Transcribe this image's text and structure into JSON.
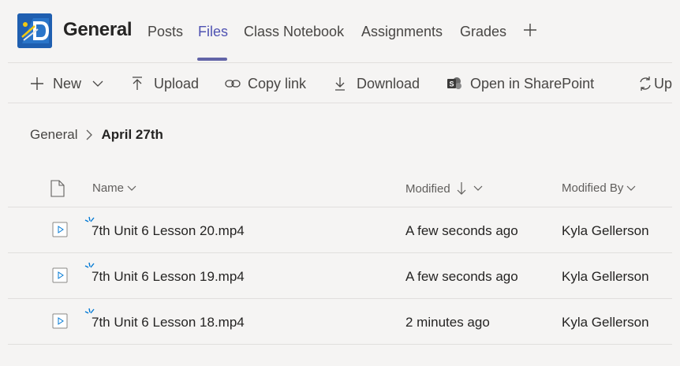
{
  "header": {
    "team_name": "General",
    "tabs": [
      {
        "label": "Posts",
        "active": false
      },
      {
        "label": "Files",
        "active": true
      },
      {
        "label": "Class Notebook",
        "active": false
      },
      {
        "label": "Assignments",
        "active": false
      },
      {
        "label": "Grades",
        "active": false
      }
    ],
    "add_tab_icon": "plus-icon"
  },
  "toolbar": {
    "new_label": "New",
    "upload_label": "Upload",
    "copy_link_label": "Copy link",
    "download_label": "Download",
    "sharepoint_label": "Open in SharePoint",
    "sync_label": "Up"
  },
  "breadcrumb": {
    "parent": "General",
    "current": "April 27th"
  },
  "table": {
    "columns": {
      "name": "Name",
      "modified": "Modified",
      "modified_by": "Modified By"
    },
    "rows": [
      {
        "name": "7th Unit 6 Lesson 20.mp4",
        "modified": "A few seconds ago",
        "modified_by": "Kyla Gellerson"
      },
      {
        "name": "7th Unit 6 Lesson 19.mp4",
        "modified": "A few seconds ago",
        "modified_by": "Kyla Gellerson"
      },
      {
        "name": "7th Unit 6 Lesson 18.mp4",
        "modified": "2 minutes ago",
        "modified_by": "Kyla Gellerson"
      }
    ]
  },
  "colors": {
    "accent": "#6264a7",
    "active_tab": "#4f52b2",
    "new_indicator": "#0078d4",
    "background": "#f5f4f3"
  }
}
